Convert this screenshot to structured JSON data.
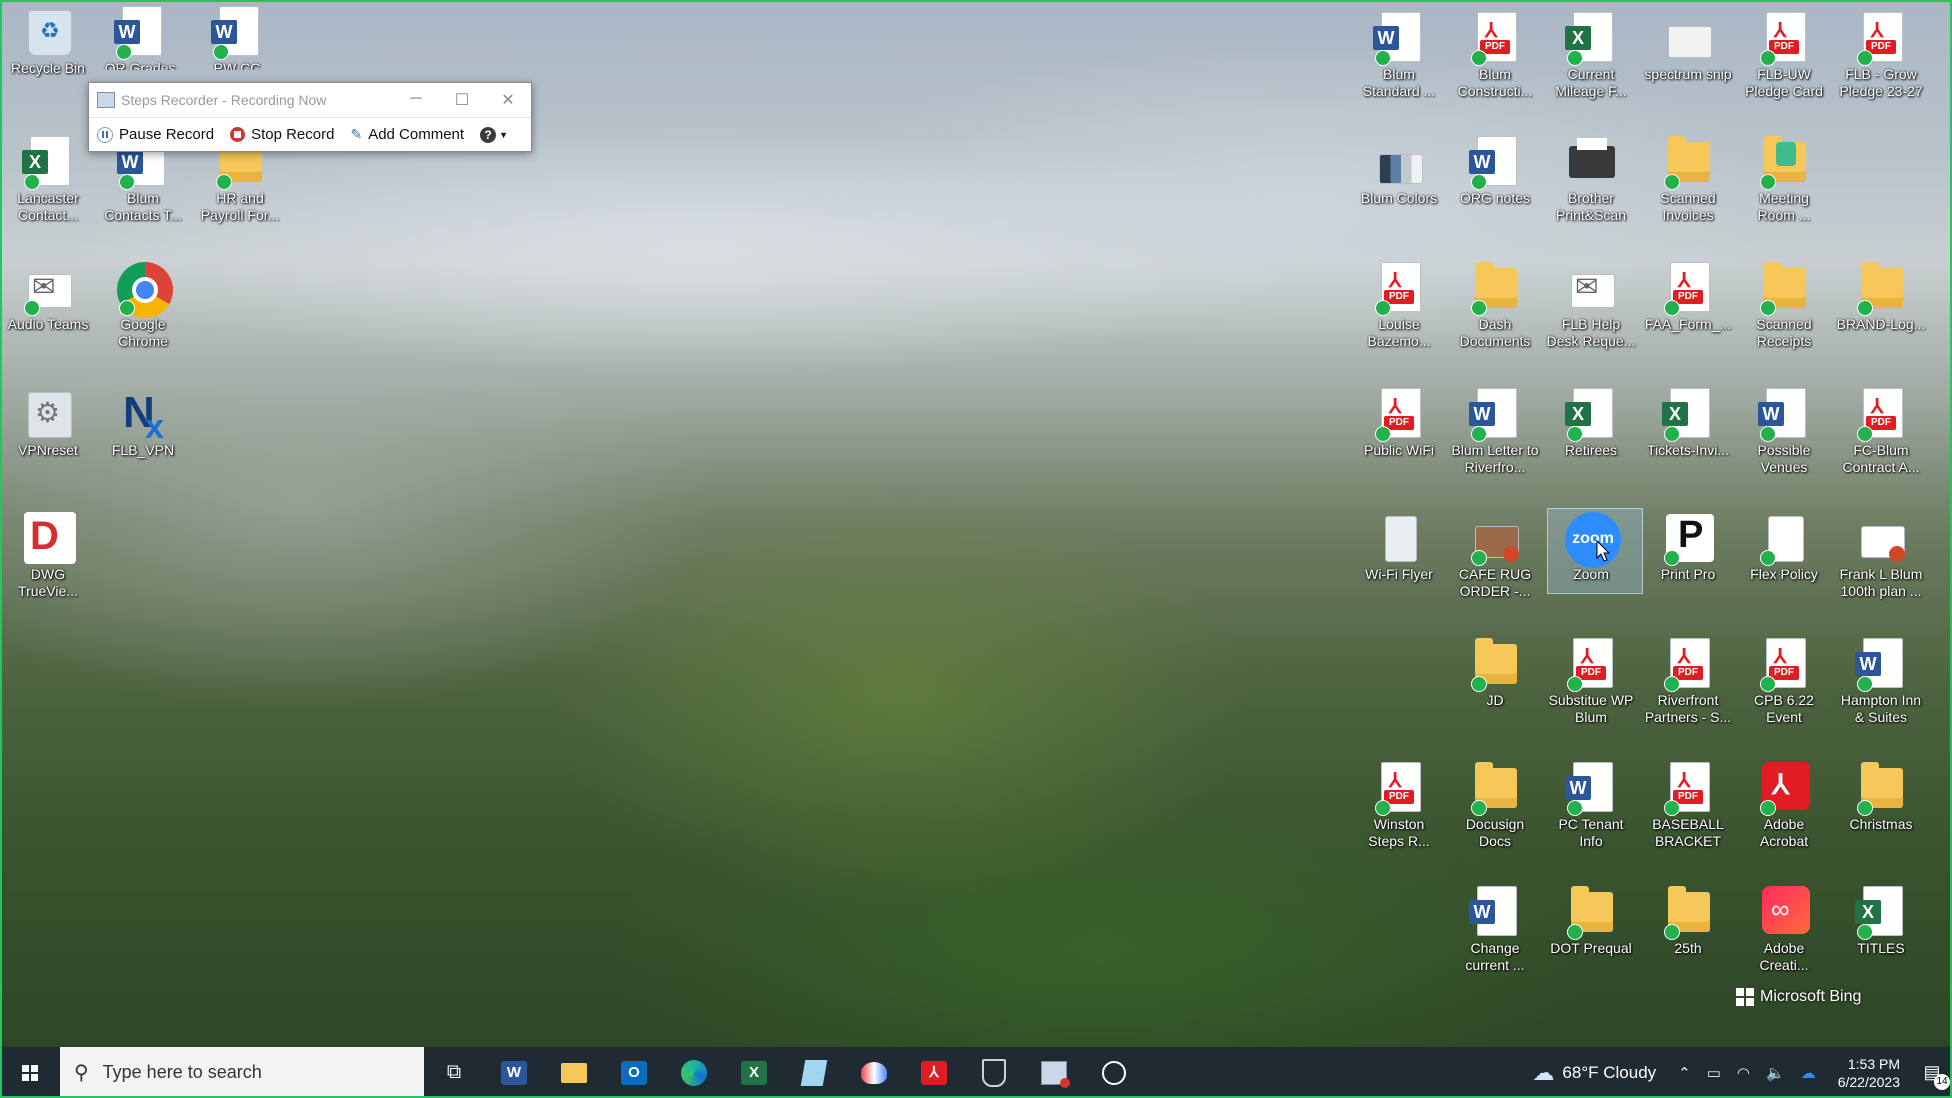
{
  "steps_recorder": {
    "title": "Steps Recorder - Recording Now",
    "pause_label": "Pause Record",
    "stop_label": "Stop Record",
    "comment_label": "Add Comment",
    "help_label": "?"
  },
  "desktop_left": {
    "recycle_bin": "Recycle Bin",
    "top_word1": "OR Grades",
    "top_word2": "PW CC",
    "lancaster": "Lancaster Contact...",
    "blum_contacts": "Blum Contacts T...",
    "hr_payroll": "HR and Payroll For...",
    "audio_teams": "Audio Teams",
    "chrome": "Google Chrome",
    "vpnreset": "VPNreset",
    "flb_vpn": "FLB_VPN",
    "dwg": "DWG TrueVie..."
  },
  "desktop_right": {
    "blum_standard": "Blum Standard ...",
    "blum_construct": "Blum Constructi...",
    "current_mileage": "Current Mileage F...",
    "spectrum_snip": "spectrum snip",
    "flb_uw_pledge": "FLB-UW Pledge Card",
    "flb_grow": "FLB - Grow Pledge 23-27",
    "blum_colors": "Blum Colors",
    "org_notes": "ORG notes",
    "brother": "Brother Print&Scan",
    "scanned_invoices": "Scanned Invoices",
    "meeting_room": "Meeting Room ...",
    "louise": "Louise Bazemo...",
    "dash_docs": "Dash Documents",
    "flb_help": "FLB Help Desk Reque...",
    "faa_form": "FAA_Form_...",
    "scanned_receipts": "Scanned Receipts",
    "brand_log": "BRAND-Log...",
    "public_wifi": "Public WiFi",
    "blum_letter": "Blum Letter to Riverfro...",
    "retirees": "Retirees",
    "tickets": "Tickets-Invi...",
    "possible_venues": "Possible Venues",
    "fc_blum": "FC-Blum Contract A...",
    "wifi_flyer": "Wi-Fi Flyer",
    "cafe_rug": "CAFE RUG ORDER -...",
    "zoom": "Zoom",
    "print_pro": "Print Pro",
    "flex_policy": "Flex Policy",
    "frank_blum": "Frank L Blum 100th plan ...",
    "jd": "JD",
    "substitue_wp": "Substitue WP Blum",
    "riverfront": "Riverfront Partners - S...",
    "cpb": "CPB 6.22 Event",
    "hampton": "Hampton Inn & Suites",
    "winston": "Winston Steps R...",
    "docusign": "Docusign Docs",
    "pc_tenant": "PC Tenant Info",
    "baseball": "BASEBALL BRACKET",
    "adobe_acrobat": "Adobe Acrobat",
    "christmas": "Christmas",
    "change_current": "Change current ...",
    "dot_prequal": "DOT Prequal",
    "twentyfifth": "25th",
    "adobe_creative": "Adobe Creati...",
    "titles": "TITLES"
  },
  "bing_label": "Microsoft Bing",
  "taskbar": {
    "search_placeholder": "Type here to search",
    "weather": "68°F  Cloudy",
    "time": "1:53 PM",
    "date": "6/22/2023",
    "notifications": "14"
  },
  "colors": {
    "accent_frame": "#22c55e",
    "word": "#2b579a",
    "excel": "#217346",
    "pdf": "#e21c23",
    "taskbar": "#1f2a33"
  }
}
